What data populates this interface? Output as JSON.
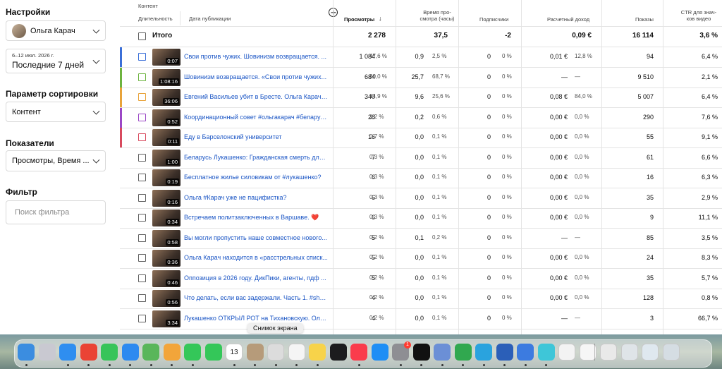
{
  "sidebar": {
    "settings_label": "Настройки",
    "account_name": "Ольга Карач",
    "date_range_small": "6–12 июл. 2026 г.",
    "date_range": "Последние 7 дней",
    "sort_label": "Параметр сортировки",
    "sort_value": "Контент",
    "metrics_label": "Показатели",
    "metrics_value": "Просмотры, Время ...",
    "filter_label": "Фильтр",
    "filter_placeholder": "Поиск фильтра"
  },
  "table": {
    "headers": {
      "content": "Контент",
      "duration": "Длительность",
      "published": "Дата публикации",
      "views": "Просмотры",
      "watch_time_1": "Время про-",
      "watch_time_2": "смотра (часы)",
      "subscribers": "Подписчики",
      "revenue": "Расчетный доход",
      "impressions": "Показы",
      "ctr_1": "CTR для знач-",
      "ctr_2": "ков видео"
    },
    "total": {
      "label": "Итого",
      "views": "2 278",
      "watch": "37,5",
      "subs": "-2",
      "revenue": "0,09 €",
      "impressions": "16 114",
      "ctr": "3,6 %"
    },
    "rows": [
      {
        "title": "Свои против чужих. Шовинизм возвращается. ...",
        "dur": "0:07",
        "views": "1 084",
        "vp": "47,6 %",
        "watch": "0,9",
        "wp": "2,5 %",
        "subs": "0",
        "sp": "0 %",
        "rev": "0,01 €",
        "rp": "12,8 %",
        "imp": "94",
        "ctr": "6,4 %",
        "color": "blue"
      },
      {
        "title": "Шовинизм возвращается. «Свои против чужих...",
        "dur": "1:08:16",
        "views": "684",
        "vp": "30,0 %",
        "watch": "25,7",
        "wp": "68,7 %",
        "subs": "0",
        "sp": "0 %",
        "rev": "—",
        "rp": "—",
        "imp": "9 510",
        "ctr": "2,1 %",
        "color": "green"
      },
      {
        "title": "Евгений Васильев убит в Бресте. Ольга Карач в...",
        "dur": "36:06",
        "views": "340",
        "vp": "14,9 %",
        "watch": "9,6",
        "wp": "25,6 %",
        "subs": "0",
        "sp": "0 %",
        "rev": "0,08 €",
        "rp": "84,0 %",
        "imp": "5 007",
        "ctr": "6,4 %",
        "color": "orange"
      },
      {
        "title": "Координационный совет #ольгакарач #беларус...",
        "dur": "0:52",
        "views": "28",
        "vp": "1,2 %",
        "watch": "0,2",
        "wp": "0,6 %",
        "subs": "0",
        "sp": "0 %",
        "rev": "0,00 €",
        "rp": "0,0 %",
        "imp": "290",
        "ctr": "7,6 %",
        "color": "purple"
      },
      {
        "title": "Еду в Барселонский университет",
        "dur": "0:11",
        "views": "16",
        "vp": "0,7 %",
        "watch": "0,0",
        "wp": "0,1 %",
        "subs": "0",
        "sp": "0 %",
        "rev": "0,00 €",
        "rp": "0,0 %",
        "imp": "55",
        "ctr": "9,1 %",
        "color": "red"
      },
      {
        "title": "Беларусь Лукашенко: Гражданская смерть для ...",
        "dur": "1:00",
        "views": "7",
        "vp": "0,3 %",
        "watch": "0,0",
        "wp": "0,1 %",
        "subs": "0",
        "sp": "0 %",
        "rev": "0,00 €",
        "rp": "0,0 %",
        "imp": "61",
        "ctr": "6,6 %",
        "color": ""
      },
      {
        "title": "Бесплатное жилье силовикам от #лукашенко?",
        "dur": "0:19",
        "views": "6",
        "vp": "0,3 %",
        "watch": "0,0",
        "wp": "0,1 %",
        "subs": "0",
        "sp": "0 %",
        "rev": "0,00 €",
        "rp": "0,0 %",
        "imp": "16",
        "ctr": "6,3 %",
        "color": ""
      },
      {
        "title": "Ольга #Карач уже не пацифистка?",
        "dur": "0:16",
        "views": "6",
        "vp": "0,3 %",
        "watch": "0,0",
        "wp": "0,1 %",
        "subs": "0",
        "sp": "0 %",
        "rev": "0,00 €",
        "rp": "0,0 %",
        "imp": "35",
        "ctr": "2,9 %",
        "color": ""
      },
      {
        "title": "Встречаем политзаключенных в Варшаве. ❤️",
        "dur": "0:34",
        "views": "6",
        "vp": "0,3 %",
        "watch": "0,0",
        "wp": "0,1 %",
        "subs": "0",
        "sp": "0 %",
        "rev": "0,00 €",
        "rp": "0,0 %",
        "imp": "9",
        "ctr": "11,1 %",
        "color": ""
      },
      {
        "title": "Вы могли пропустить наше совместное новогo...",
        "dur": "0:58",
        "views": "5",
        "vp": "0,2 %",
        "watch": "0,1",
        "wp": "0,2 %",
        "subs": "0",
        "sp": "0 %",
        "rev": "—",
        "rp": "—",
        "imp": "85",
        "ctr": "3,5 %",
        "color": ""
      },
      {
        "title": "Ольга Карач находится в «расстрельных списк...",
        "dur": "0:36",
        "views": "5",
        "vp": "0,2 %",
        "watch": "0,0",
        "wp": "0,1 %",
        "subs": "0",
        "sp": "0 %",
        "rev": "0,00 €",
        "rp": "0,0 %",
        "imp": "24",
        "ctr": "8,3 %",
        "color": ""
      },
      {
        "title": "Оппозиция в 2026 году. ДикПики, агенты, пдф ...",
        "dur": "0:46",
        "views": "5",
        "vp": "0,2 %",
        "watch": "0,0",
        "wp": "0,1 %",
        "subs": "0",
        "sp": "0 %",
        "rev": "0,00 €",
        "rp": "0,0 %",
        "imp": "35",
        "ctr": "5,7 %",
        "color": ""
      },
      {
        "title": "Что делать, если вас задержали. Часть 1. #shor...",
        "dur": "0:56",
        "views": "4",
        "vp": "0,2 %",
        "watch": "0,0",
        "wp": "0,1 %",
        "subs": "0",
        "sp": "0 %",
        "rev": "0,00 €",
        "rp": "0,0 %",
        "imp": "128",
        "ctr": "0,8 %",
        "color": ""
      },
      {
        "title": "Лукашенко ОТКРЫЛ РОТ на Тихановскую. Ольг...",
        "dur": "3:34",
        "views": "4",
        "vp": "0,2 %",
        "watch": "0,0",
        "wp": "0,1 %",
        "subs": "0",
        "sp": "0 %",
        "rev": "—",
        "rp": "—",
        "imp": "3",
        "ctr": "66,7 %",
        "color": ""
      }
    ]
  },
  "tooltip": "Снимок экрана",
  "dock": {
    "calendar_day": "13",
    "badge_count": "1",
    "apps": [
      {
        "name": "finder",
        "color": "#3b8de0",
        "label": ""
      },
      {
        "name": "launchpad",
        "color": "#c9c9d1",
        "label": ""
      },
      {
        "name": "safari",
        "color": "#2f8ef0",
        "label": ""
      },
      {
        "name": "chrome",
        "color": "#ea4335",
        "label": ""
      },
      {
        "name": "messages",
        "color": "#38c45a",
        "label": ""
      },
      {
        "name": "mail",
        "color": "#2d8af0",
        "label": ""
      },
      {
        "name": "maps",
        "color": "#59b65a",
        "label": ""
      },
      {
        "name": "photos",
        "color": "#f2a53a",
        "label": ""
      },
      {
        "name": "facetime",
        "color": "#34c759",
        "label": ""
      },
      {
        "name": "phone",
        "color": "#34c759",
        "label": ""
      },
      {
        "name": "calendar",
        "color": "#ffffff",
        "label": ""
      },
      {
        "name": "contacts",
        "color": "#b69b7a",
        "label": ""
      },
      {
        "name": "screenshot",
        "color": "#dcdcdc",
        "label": ""
      },
      {
        "name": "reminders",
        "color": "#f5f5f5",
        "label": ""
      },
      {
        "name": "notes",
        "color": "#f7d34a",
        "label": ""
      },
      {
        "name": "appletv",
        "color": "#1c1c1e",
        "label": ""
      },
      {
        "name": "music",
        "color": "#fa3c4c",
        "label": ""
      },
      {
        "name": "appstore",
        "color": "#1e8ef5",
        "label": ""
      },
      {
        "name": "settings",
        "color": "#8e8e93",
        "label": ""
      },
      {
        "name": "capcut",
        "color": "#111111",
        "label": ""
      },
      {
        "name": "preview",
        "color": "#6b8fd6",
        "label": ""
      },
      {
        "name": "numbers",
        "color": "#31a84f",
        "label": ""
      },
      {
        "name": "telegram",
        "color": "#2aa3de",
        "label": ""
      },
      {
        "name": "word",
        "color": "#2b5fb8",
        "label": ""
      },
      {
        "name": "quicktime",
        "color": "#3c7be0",
        "label": ""
      },
      {
        "name": "canva",
        "color": "#3ec6d8",
        "label": ""
      },
      {
        "name": "textedit",
        "color": "#f3f3f3",
        "label": ""
      },
      {
        "name": "doc-1",
        "color": "#f6f6f6",
        "label": ""
      },
      {
        "name": "doc-2",
        "color": "#e9e9e9",
        "label": ""
      },
      {
        "name": "doc-3",
        "color": "#dfe4e8",
        "label": ""
      },
      {
        "name": "doc-4",
        "color": "#dfe8ef",
        "label": ""
      },
      {
        "name": "doc-5",
        "color": "#d5dde3",
        "label": ""
      }
    ]
  }
}
